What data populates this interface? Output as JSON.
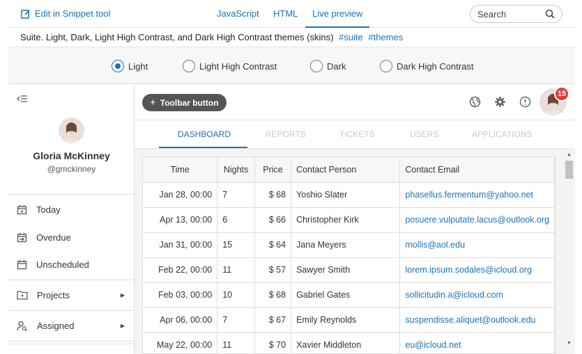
{
  "topbar": {
    "edit_link": "Edit in Snippet tool",
    "tabs": [
      "JavaScript",
      "HTML",
      "Live preview"
    ],
    "search_placeholder": "Search"
  },
  "description": {
    "text": "Suite. Light, Dark, Light High Contrast, and Dark High Contrast themes (skins)",
    "tags": [
      "#suite",
      "#themes"
    ]
  },
  "themes": {
    "options": [
      "Light",
      "Light High Contrast",
      "Dark",
      "Dark High Contrast"
    ],
    "selected": "Light"
  },
  "sidebar": {
    "user_name": "Gloria McKinney",
    "user_handle": "@gmckinney",
    "items": [
      {
        "label": "Today",
        "icon": "calendar-star-icon"
      },
      {
        "label": "Overdue",
        "icon": "calendar-arrow-icon"
      },
      {
        "label": "Unscheduled",
        "icon": "calendar-blank-icon"
      },
      {
        "label": "Projects",
        "icon": "folder-star-icon"
      },
      {
        "label": "Assigned",
        "icon": "user-search-icon"
      }
    ]
  },
  "toolbar": {
    "button_label": "Toolbar button",
    "badge_count": "15"
  },
  "nav": {
    "tabs": [
      "Dashboard",
      "Reports",
      "Tickets",
      "Users",
      "Applications"
    ],
    "active": "Dashboard"
  },
  "grid": {
    "columns": [
      "Time",
      "Nights",
      "Price",
      "Contact Person",
      "Contact Email"
    ],
    "rows": [
      [
        "Jan 28, 00:00",
        "7",
        "$ 68",
        "Yoshio Slater",
        "phasellus.fermentum@yahoo.net"
      ],
      [
        "Apr 13, 00:00",
        "6",
        "$ 66",
        "Christopher Kirk",
        "posuere.vulputate.lacus@outlook.org"
      ],
      [
        "Jan 31, 00:00",
        "15",
        "$ 64",
        "Jana Meyers",
        "mollis@aol.edu"
      ],
      [
        "Feb 22, 00:00",
        "11",
        "$ 57",
        "Sawyer Smith",
        "lorem.ipsum.sodales@icloud.org"
      ],
      [
        "Feb 03, 00:00",
        "10",
        "$ 68",
        "Gabriel Gates",
        "sollicitudin.a@icloud.com"
      ],
      [
        "Apr 06, 00:00",
        "7",
        "$ 67",
        "Emily Reynolds",
        "suspendisse.aliquet@outlook.edu"
      ],
      [
        "May 22, 00:00",
        "11",
        "$ 70",
        "Xavier Middleton",
        "eu@icloud.net"
      ]
    ]
  },
  "colors": {
    "accent": "#1a73b8",
    "badge": "#e53935",
    "toolbar_button": "#555555"
  }
}
